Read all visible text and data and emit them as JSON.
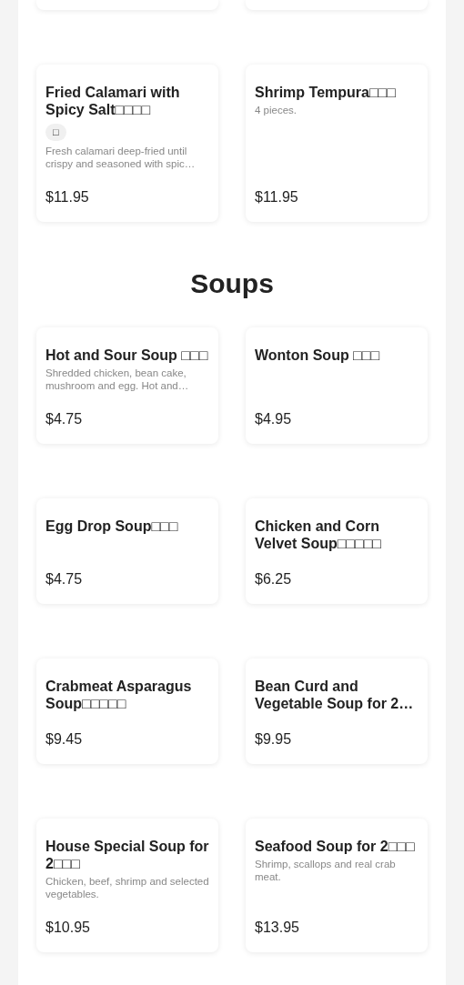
{
  "sections": [
    {
      "items": [
        {
          "name": "Fried Calamari with Spicy Salt□□□□",
          "tags": [
            "□"
          ],
          "description": "Fresh calamari deep-fried until crispy and seasoned with spic…",
          "price": "$11.95"
        },
        {
          "name": "Shrimp Tempura□□□",
          "description": "4 pieces.",
          "price": "$11.95"
        }
      ]
    },
    {
      "title": "Soups",
      "items": [
        {
          "name": "Hot and Sour Soup □□□",
          "description": "Shredded chicken, bean cake, mushroom and egg. Hot and…",
          "price": "$4.75"
        },
        {
          "name": "Wonton Soup □□□",
          "price": "$4.95"
        },
        {
          "name": "Egg Drop Soup□□□",
          "price": "$4.75"
        },
        {
          "name": "Chicken and Corn Velvet Soup□□□□□",
          "price": "$6.25"
        },
        {
          "name": "Crabmeat Asparagus Soup□□□□□",
          "price": "$9.45"
        },
        {
          "name": "Bean Curd and Vegetable Soup for 2…",
          "price": "$9.95"
        },
        {
          "name": "House Special Soup for 2□□□",
          "description": "Chicken, beef, shrimp and selected vegetables.",
          "price": "$10.95"
        },
        {
          "name": "Seafood Soup for 2□□□",
          "description": "Shrimp, scallops and real crab meat.",
          "price": "$13.95"
        }
      ]
    }
  ]
}
